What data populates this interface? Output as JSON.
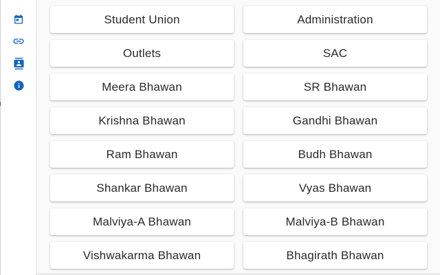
{
  "sidebar": {
    "items": [
      {
        "icon": "calendar-icon",
        "name": "sidebar-calendar-button"
      },
      {
        "icon": "link-icon",
        "name": "sidebar-link-button"
      },
      {
        "icon": "contact-card-icon",
        "name": "sidebar-contacts-button"
      },
      {
        "icon": "info-icon",
        "name": "sidebar-info-button"
      }
    ],
    "icon_color": "#1565c0"
  },
  "places": [
    {
      "label": "Student Union"
    },
    {
      "label": "Administration"
    },
    {
      "label": "Outlets"
    },
    {
      "label": "SAC"
    },
    {
      "label": "Meera Bhawan"
    },
    {
      "label": "SR Bhawan"
    },
    {
      "label": "Krishna Bhawan"
    },
    {
      "label": "Gandhi Bhawan"
    },
    {
      "label": "Ram Bhawan"
    },
    {
      "label": "Budh Bhawan"
    },
    {
      "label": "Shankar Bhawan"
    },
    {
      "label": "Vyas Bhawan"
    },
    {
      "label": "Malviya-A Bhawan"
    },
    {
      "label": "Malviya-B Bhawan"
    },
    {
      "label": "Vishwakarma Bhawan"
    },
    {
      "label": "Bhagirath Bhawan"
    }
  ]
}
